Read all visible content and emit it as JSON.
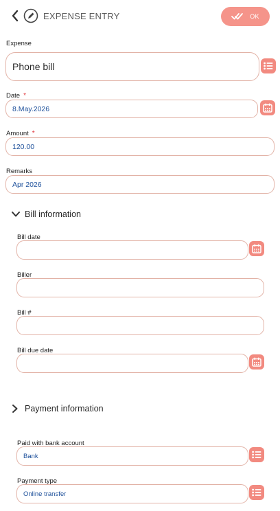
{
  "header": {
    "title": "EXPENSE ENTRY",
    "ok_label": "OK"
  },
  "expense": {
    "label": "Expense",
    "value": "Phone bill"
  },
  "date": {
    "label": "Date",
    "required_mark": "*",
    "value": "8.May.2026"
  },
  "amount": {
    "label": "Amount",
    "required_mark": "*",
    "value": "120.00"
  },
  "remarks": {
    "label": "Remarks",
    "value": "Apr 2026"
  },
  "bill_section": {
    "title": "Bill information",
    "bill_date": {
      "label": "Bill date",
      "value": ""
    },
    "biller": {
      "label": "Biller",
      "value": ""
    },
    "bill_number": {
      "label": "Bill #",
      "value": ""
    },
    "bill_due_date": {
      "label": "Bill due date",
      "value": ""
    }
  },
  "payment_section": {
    "title": "Payment information",
    "paid_with": {
      "label": "Paid with bank account",
      "value": "Bank"
    },
    "payment_type": {
      "label": "Payment type",
      "value": "Online transfer"
    }
  },
  "colors": {
    "accent": "#f28a80",
    "field_border": "#e2b2a6",
    "value_text": "#1c4f9a",
    "required": "#e0343a"
  },
  "icons": [
    "back-arrow-icon",
    "pencil-icon",
    "double-check-icon",
    "list-icon",
    "calendar-icon",
    "chevron-down-icon",
    "chevron-right-icon"
  ]
}
